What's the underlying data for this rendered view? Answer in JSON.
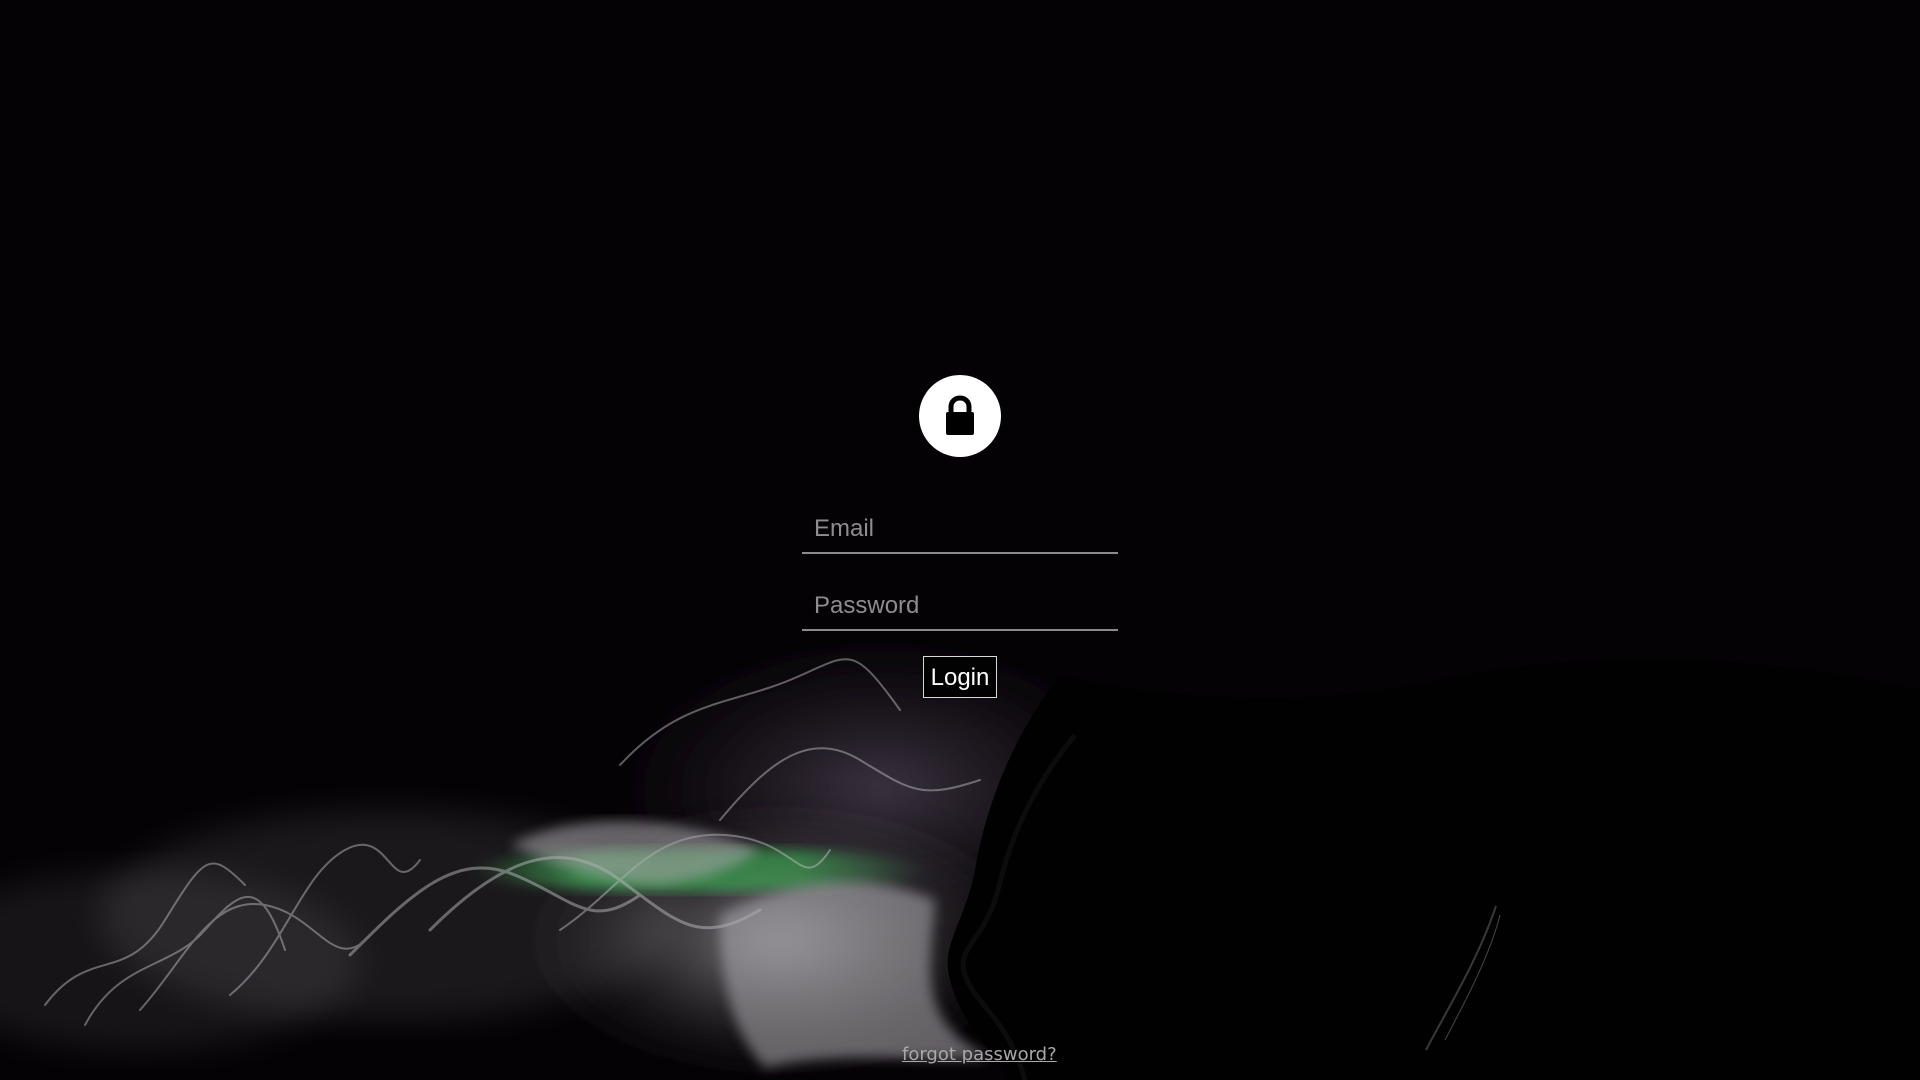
{
  "background": {
    "theme": "dark smoke",
    "colors": {
      "base": "#050205",
      "smoke": "#b9b6bd",
      "green_glow": "#3fd85d",
      "purple_haze": "#8f7b9a"
    }
  },
  "login": {
    "icon": "lock-icon",
    "email_placeholder": "Email",
    "password_placeholder": "Password",
    "button_label": "Login",
    "forgot_password_label": "forgot password?"
  }
}
